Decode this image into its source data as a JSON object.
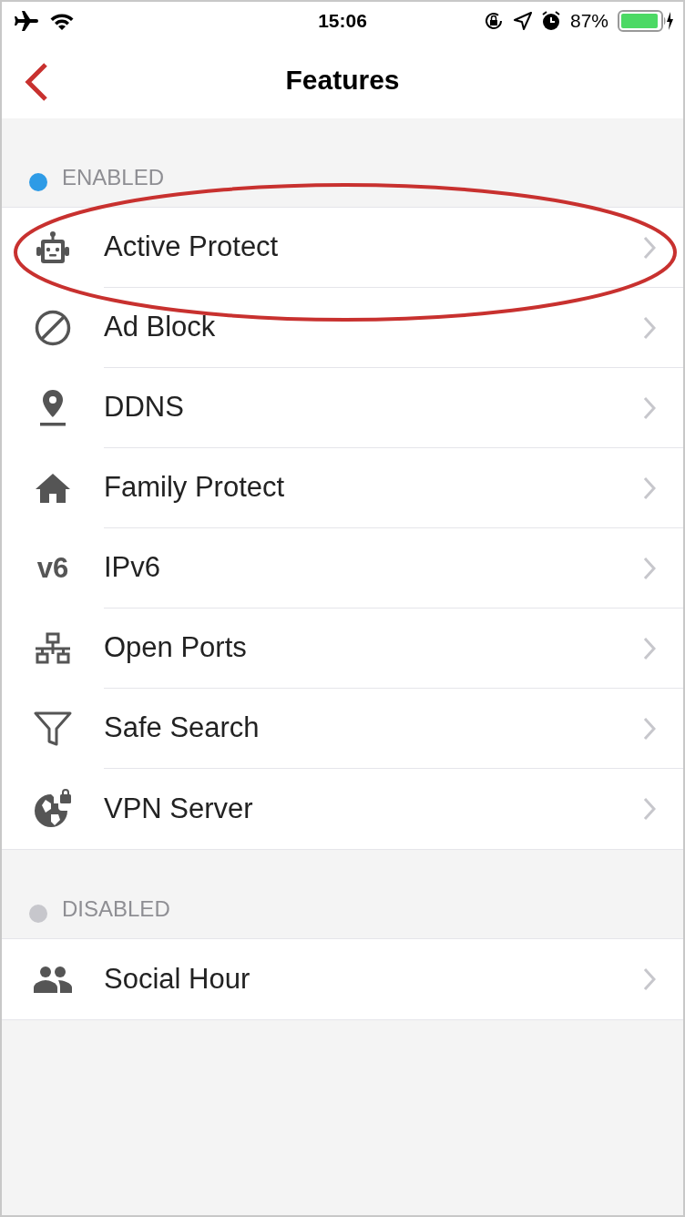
{
  "status_bar": {
    "time": "15:06",
    "battery": "87%"
  },
  "nav": {
    "title": "Features"
  },
  "sections": [
    {
      "title": "ENABLED",
      "color": "#2e9be6",
      "items": [
        {
          "label": "Active Protect",
          "circled": true
        },
        {
          "label": "Ad Block",
          "circled": false
        },
        {
          "label": "DDNS",
          "circled": false
        },
        {
          "label": "Family Protect",
          "circled": false
        },
        {
          "label": "IPv6",
          "icon_text": "v6",
          "circled": false
        },
        {
          "label": "Open Ports",
          "circled": false
        },
        {
          "label": "Safe Search",
          "circled": false
        },
        {
          "label": "VPN Server",
          "circled": false
        }
      ]
    },
    {
      "title": "DISABLED",
      "color": "#c7c7cc",
      "items": [
        {
          "label": "Social Hour",
          "circled": false
        }
      ]
    }
  ]
}
